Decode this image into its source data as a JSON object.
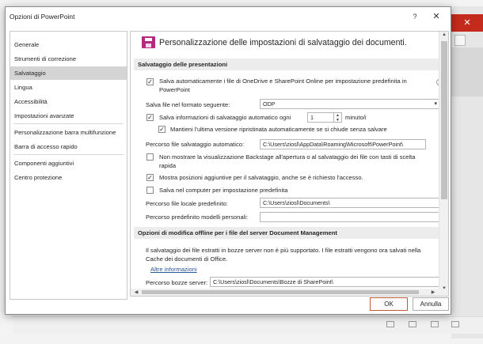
{
  "dialog": {
    "title": "Opzioni di PowerPoint",
    "help_glyph": "?",
    "close_glyph": "✕"
  },
  "background": {
    "close_glyph": "✕"
  },
  "nav": {
    "items": [
      {
        "label": "Generale"
      },
      {
        "label": "Strumenti di correzione"
      },
      {
        "label": "Salvataggio",
        "selected": true
      },
      {
        "label": "Lingua"
      },
      {
        "label": "Accessibilità"
      },
      {
        "label": "Impostazioni avanzate"
      },
      {
        "label": "Personalizzazione barra multifunzione"
      },
      {
        "label": "Barra di accesso rapido"
      },
      {
        "label": "Componenti aggiuntivi"
      },
      {
        "label": "Centro protezione"
      }
    ]
  },
  "content": {
    "header_title": "Personalizzazione delle impostazioni di salvataggio dei documenti.",
    "section1": {
      "title": "Salvataggio delle presentazioni",
      "autosave_onedrive": {
        "checked": true,
        "label_line1": "Salva automaticamente i file di OneDrive e SharePoint Online per impostazione predefinita in",
        "label_line2": "PowerPoint"
      },
      "format": {
        "label": "Salva file nel formato seguente:",
        "value": "ODP"
      },
      "autorecover": {
        "checked": true,
        "label": "Salva informazioni di salvataggio automatico ogni",
        "minutes": "1",
        "unit": "minuto/i"
      },
      "keep_last": {
        "checked": true,
        "label": "Mantieni l'ultima versione ripristinata automaticamente se si chiude senza salvare"
      },
      "autorecover_path": {
        "label": "Percorso file salvataggio automatico:",
        "value": "C:\\Users\\ziosl\\AppData\\Roaming\\Microsoft\\PowerPoint\\"
      },
      "no_backstage": {
        "checked": false,
        "label_line1": "Non mostrare la visualizzazione Backstage all'apertura o al salvataggio dei file con tasti di scelta",
        "label_line2": "rapida"
      },
      "show_places": {
        "checked": true,
        "label": "Mostra posizioni aggiuntive per il salvataggio, anche se è richiesto l'accesso."
      },
      "save_computer": {
        "checked": false,
        "label": "Salva nel computer per impostazione predefinita"
      },
      "default_local": {
        "label": "Percorso file locale predefinito:",
        "value": "C:\\Users\\ziosl\\Documents\\"
      },
      "templates_path": {
        "label": "Percorso predefinito modelli personali:",
        "value": ""
      }
    },
    "section2": {
      "title": "Opzioni di modifica offline per i file del server Document Management",
      "text_line1": "Il salvataggio dei file estratti in bozze server non è più supportato. I file estratti vengono ora salvati nella",
      "text_line2": "Cache dei documenti di Office.",
      "more_info": "Altre informazioni",
      "drafts": {
        "label": "Percorso bozze server:",
        "value": "C:\\Users\\ziosl\\Documents\\Bozze di SharePoint\\"
      }
    }
  },
  "buttons": {
    "ok": "OK",
    "cancel": "Annulla"
  }
}
